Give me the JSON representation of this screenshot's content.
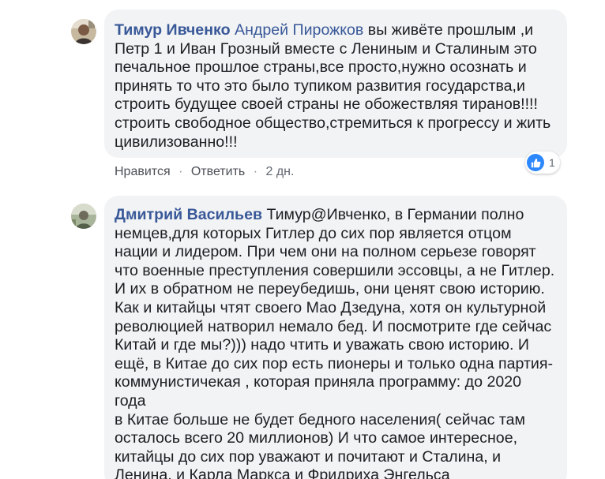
{
  "comments": [
    {
      "author": "Тимур Ивченко",
      "mention": "Андрей Пирожков",
      "text": " вы живёте прошлым ,и\nПетр 1 и Иван Грозный вместе с Лениным и Сталиным это\nпечальное прошлое страны,все просто,нужно осознать и\nпринять то что это было тупиком развития государства,и\nстроить будущее своей страны не обожествляя тиранов!!!!\nстроить свободное общество,стремиться к прогрессу и жить\nцивилизованно!!!",
      "actions": {
        "like": "Нравится",
        "reply": "Ответить",
        "time": "2 дн.",
        "separator": "·"
      },
      "reactions": {
        "icon": "like-icon",
        "count": "1"
      }
    },
    {
      "author": "Дмитрий Васильев",
      "text": " Тимур@Ивченко, в Германии полно\nнемцев,для которых Гитлер до сих пор является отцом\nнации и лидером. При чем они на полном серьезе говорят\nчто военные преступления совершили эссовцы, а не Гитлер.\nИ их в обратном не переубедишь, они ценят свою историю.\nКак и китайцы чтят своего Мао Дзедуна, хотя он культурной\nреволюцией натворил немало бед. И посмотрите где сейчас\nКитай и где мы?))) надо чтить и уважать свою историю. И\nещё, в Китае до сих пор есть пионеры и только одна партия-\nкоммунистичекая , которая приняла программу: до 2020 года\nв Китае больше не будет бедного населения( сейчас там\nосталось всего 20 миллионов) И что самое интересное,\nкитайцы до сих пор уважают и почитают и Сталина, и\nЛенина, и Карла Маркса и Фридриха Энгельса"
    }
  ],
  "colors": {
    "bubble": "#f2f3f5",
    "author": "#385898",
    "text": "#1c1e21",
    "meta": "#606770",
    "like_badge": "#2d88ff"
  }
}
